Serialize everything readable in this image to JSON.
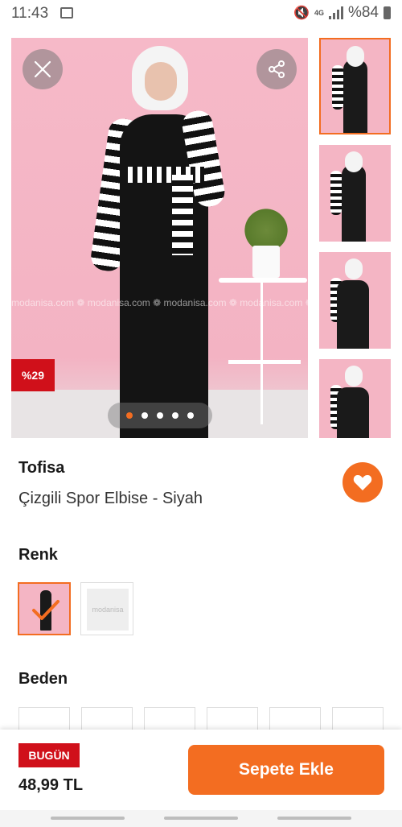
{
  "status_bar": {
    "time": "11:43",
    "network": "4G",
    "battery": "%84"
  },
  "gallery": {
    "discount_badge": "%29",
    "watermark": "modanisa.com  ❁  modanisa.com  ❁  modanisa.com  ❁  modanisa.com  ❁  modanisa.com",
    "total_images": 5,
    "active_index": 0,
    "thumbnail_count": 4,
    "selected_thumbnail": 0
  },
  "product": {
    "brand": "Tofisa",
    "name": "Çizgili Spor Elbise - Siyah"
  },
  "color_section": {
    "title": "Renk",
    "unselected_swatch_text": "modanisa"
  },
  "size_section": {
    "title": "Beden"
  },
  "purchase": {
    "badge": "BUGÜN",
    "price": "48,99 TL",
    "add_to_cart_label": "Sepete Ekle"
  },
  "colors": {
    "accent": "#f36d21",
    "badge_red": "#d0101a"
  },
  "icons": {
    "close": "close-icon",
    "share": "share-icon",
    "favorite": "heart-icon",
    "check": "check-icon"
  }
}
